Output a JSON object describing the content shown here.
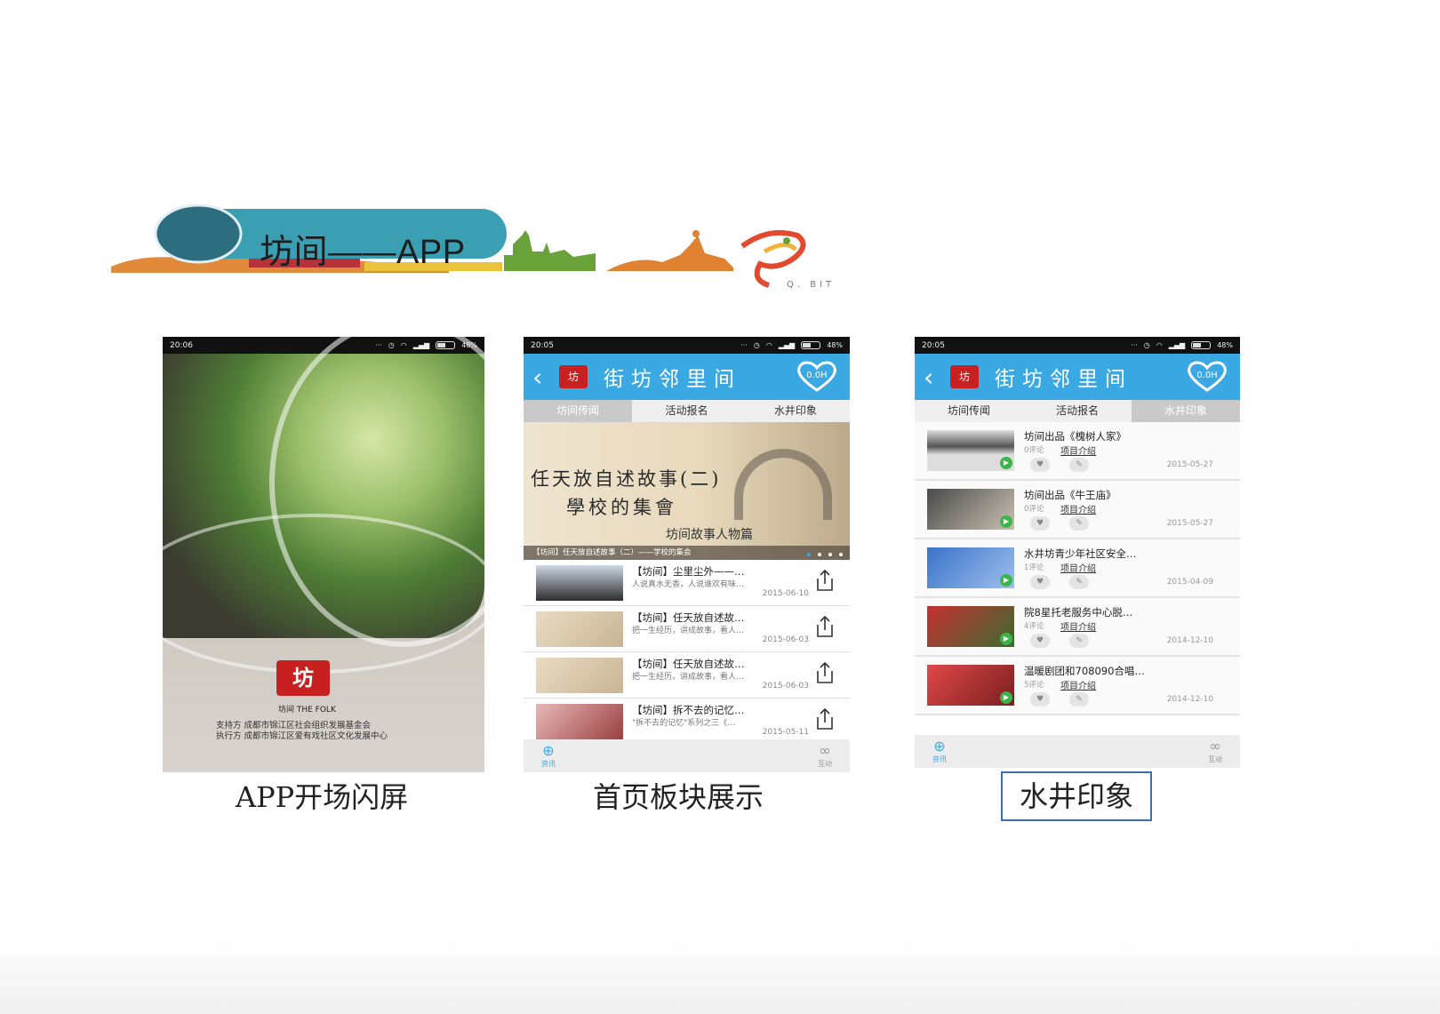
{
  "banner": {
    "title": "坊间——APP",
    "credit": "Q. BIT"
  },
  "colors": {
    "accent": "#3aa9e3",
    "banner_teal": "#3b9fb4",
    "logo_red": "#c82020"
  },
  "phones": {
    "splash": {
      "statusbar": {
        "time": "20:06",
        "battery": "48%"
      },
      "logo_char": "坊",
      "logo_text": "坊间 THE FOLK",
      "support_line": "支持方  成都市锦江区社会组织发展基金会",
      "executor_line": "执行方  成都市锦江区爱有戏社区文化发展中心"
    },
    "home": {
      "statusbar": {
        "time": "20:05",
        "battery": "48%"
      },
      "header": {
        "title": "街坊邻里间",
        "logo_char": "坊",
        "badge": "0.0H"
      },
      "tabs": [
        {
          "label": "坊间传闻"
        },
        {
          "label": "活动报名"
        },
        {
          "label": "水井印象"
        }
      ],
      "hero": {
        "line1": "任天放自述故事(二)",
        "line2": "學校的集會",
        "sub": "坊间故事人物篇",
        "caption": "【坊间】任天放自述故事（二）——学校的集会"
      },
      "news": [
        {
          "title": "【坊间】尘里尘外——…",
          "summary": "人说真水无香，人说谁欢有味…",
          "date": "2015-06-10"
        },
        {
          "title": "【坊间】任天放自述故…",
          "summary": "把一生经历，讲成故事，看人…",
          "date": "2015-06-03"
        },
        {
          "title": "【坊间】任天放自述故…",
          "summary": "把一生经历，讲成故事，看人…",
          "date": "2015-06-03"
        },
        {
          "title": "【坊间】拆不去的记忆…",
          "summary": "\"拆不去的记忆\"系列之三《…",
          "date": "2015-05-11"
        }
      ],
      "nav": {
        "left": "资讯",
        "right": "互动"
      }
    },
    "well": {
      "statusbar": {
        "time": "20:05",
        "battery": "48%"
      },
      "header": {
        "title": "街坊邻里间",
        "logo_char": "坊",
        "badge": "0.0H"
      },
      "tabs": [
        {
          "label": "坊间传闻"
        },
        {
          "label": "活动报名"
        },
        {
          "label": "水井印象"
        }
      ],
      "items": [
        {
          "title": "坊间出品《槐树人家》",
          "comments": "0评论",
          "link": "项目介绍",
          "date": "2015-05-27"
        },
        {
          "title": "坊间出品《牛王庙》",
          "comments": "0评论",
          "link": "项目介绍",
          "date": "2015-05-27"
        },
        {
          "title": "水井坊青少年社区安全…",
          "comments": "1评论",
          "link": "项目介绍",
          "date": "2015-04-09"
        },
        {
          "title": "院8星托老服务中心脱…",
          "comments": "4评论",
          "link": "项目介绍",
          "date": "2014-12-10"
        },
        {
          "title": "温暖剧团和708090合唱…",
          "comments": "5评论",
          "link": "项目介绍",
          "date": "2014-12-10"
        }
      ],
      "nav": {
        "left": "资讯",
        "right": "互动"
      }
    }
  },
  "captions": {
    "splash": "APP开场闪屏",
    "home": "首页板块展示",
    "well": "水井印象"
  }
}
